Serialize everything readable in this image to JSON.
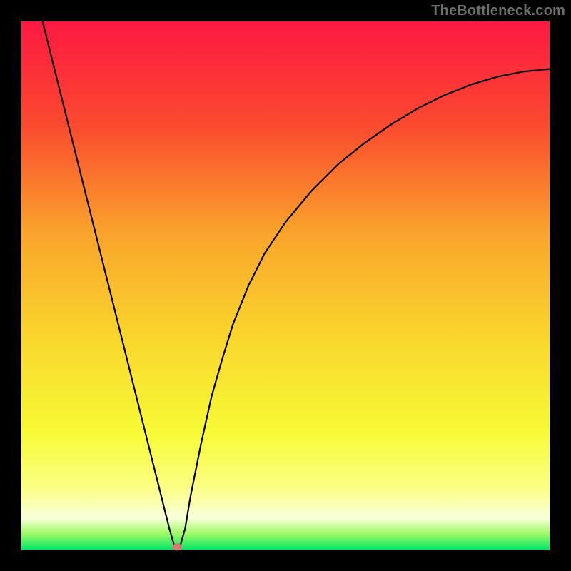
{
  "watermark": "TheBottleneck.com",
  "chart_data": {
    "type": "line",
    "title": "",
    "xlabel": "",
    "ylabel": "",
    "xlim": [
      0,
      100
    ],
    "ylim": [
      0,
      100
    ],
    "background_gradient": {
      "stops": [
        {
          "pos": 0.0,
          "color": "#fd1942"
        },
        {
          "pos": 0.2,
          "color": "#fb4b2f"
        },
        {
          "pos": 0.4,
          "color": "#faa42b"
        },
        {
          "pos": 0.6,
          "color": "#fad62c"
        },
        {
          "pos": 0.78,
          "color": "#f7fb36"
        },
        {
          "pos": 0.88,
          "color": "#fbff82"
        },
        {
          "pos": 0.94,
          "color": "#faffd9"
        },
        {
          "pos": 0.97,
          "color": "#9efa66"
        },
        {
          "pos": 1.0,
          "color": "#00e765"
        }
      ]
    },
    "series": [
      {
        "name": "curve",
        "color": "#000000",
        "points": [
          {
            "x": 4.0,
            "y": 100.0
          },
          {
            "x": 6.0,
            "y": 92.0
          },
          {
            "x": 8.0,
            "y": 84.0
          },
          {
            "x": 10.0,
            "y": 76.0
          },
          {
            "x": 12.0,
            "y": 68.0
          },
          {
            "x": 14.0,
            "y": 60.0
          },
          {
            "x": 16.0,
            "y": 52.0
          },
          {
            "x": 18.0,
            "y": 44.0
          },
          {
            "x": 20.0,
            "y": 36.0
          },
          {
            "x": 22.0,
            "y": 28.0
          },
          {
            "x": 24.0,
            "y": 20.0
          },
          {
            "x": 26.0,
            "y": 12.0
          },
          {
            "x": 27.0,
            "y": 8.0
          },
          {
            "x": 28.0,
            "y": 4.0
          },
          {
            "x": 29.0,
            "y": 0.5
          },
          {
            "x": 30.0,
            "y": 0.5
          },
          {
            "x": 31.0,
            "y": 4.0
          },
          {
            "x": 32.0,
            "y": 10.0
          },
          {
            "x": 34.0,
            "y": 20.0
          },
          {
            "x": 36.0,
            "y": 29.0
          },
          {
            "x": 38.0,
            "y": 36.0
          },
          {
            "x": 40.0,
            "y": 42.5
          },
          {
            "x": 43.0,
            "y": 50.0
          },
          {
            "x": 46.0,
            "y": 56.0
          },
          {
            "x": 50.0,
            "y": 62.0
          },
          {
            "x": 55.0,
            "y": 68.0
          },
          {
            "x": 60.0,
            "y": 73.0
          },
          {
            "x": 65.0,
            "y": 77.0
          },
          {
            "x": 70.0,
            "y": 80.5
          },
          {
            "x": 75.0,
            "y": 83.5
          },
          {
            "x": 80.0,
            "y": 86.0
          },
          {
            "x": 85.0,
            "y": 88.0
          },
          {
            "x": 90.0,
            "y": 89.5
          },
          {
            "x": 95.0,
            "y": 90.5
          },
          {
            "x": 100.0,
            "y": 91.0
          }
        ]
      }
    ],
    "marker": {
      "x": 29.5,
      "y": 0.5,
      "color": "#d67c76",
      "rx": 7,
      "ry": 5
    }
  }
}
